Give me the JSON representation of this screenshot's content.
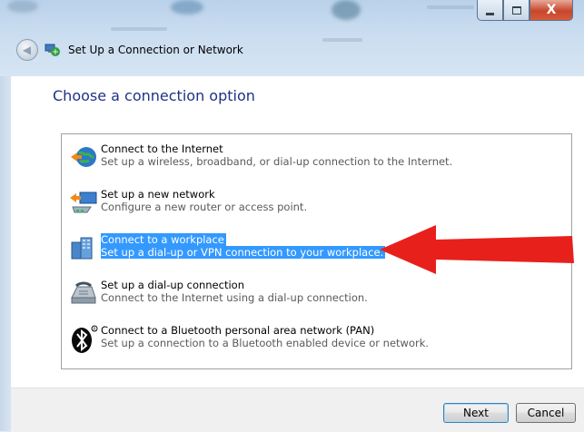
{
  "window": {
    "title": "Set Up a Connection or Network",
    "close_glyph": "X"
  },
  "heading": "Choose a connection option",
  "options": [
    {
      "title": "Connect to the Internet",
      "description": "Set up a wireless, broadband, or dial-up connection to the Internet.",
      "icon": "globe-network-icon"
    },
    {
      "title": "Set up a new network",
      "description": "Configure a new router or access point.",
      "icon": "router-icon"
    },
    {
      "title": "Connect to a workplace",
      "description": "Set up a dial-up or VPN connection to your workplace.",
      "icon": "workplace-icon",
      "selected": true
    },
    {
      "title": "Set up a dial-up connection",
      "description": "Connect to the Internet using a dial-up connection.",
      "icon": "phone-modem-icon"
    },
    {
      "title": "Connect to a Bluetooth personal area network (PAN)",
      "description": "Set up a connection to a Bluetooth enabled device or network.",
      "icon": "bluetooth-icon"
    }
  ],
  "buttons": {
    "next": "Next",
    "cancel": "Cancel"
  },
  "colors": {
    "selection": "#3399ff",
    "heading": "#1e3287",
    "annotation_arrow": "#e8201c"
  }
}
